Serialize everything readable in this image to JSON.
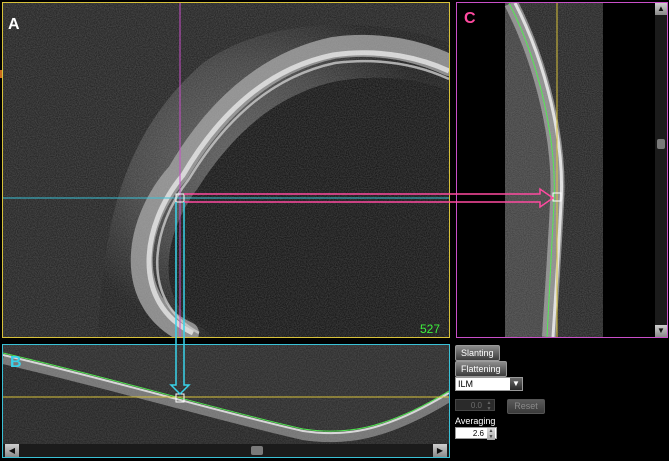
{
  "panels": {
    "a": {
      "label": "A",
      "slice_number": "527"
    },
    "b": {
      "label": "B"
    },
    "c": {
      "label": "C"
    }
  },
  "controls": {
    "slanting_label": "Slanting",
    "flattening_label": "Flattening",
    "layer_value": "ILM",
    "offset_value": "0.0",
    "reset_label": "Reset",
    "averaging_label": "Averaging",
    "averaging_value": "2.6"
  },
  "icons": {
    "scroll_up": "triangle-up",
    "scroll_down": "triangle-down",
    "scroll_left": "triangle-left",
    "scroll_right": "triangle-right",
    "dropdown": "chevron-down"
  },
  "colors": {
    "panel_a_border": "#d8c23a",
    "panel_b_border": "#39c1d6",
    "panel_c_border": "#c94fc9",
    "crosshair_cyan": "#39d3ea",
    "crosshair_magenta": "#ff4aa0",
    "segmentation_line": "#3df03d",
    "slice_number": "#3df03d"
  }
}
